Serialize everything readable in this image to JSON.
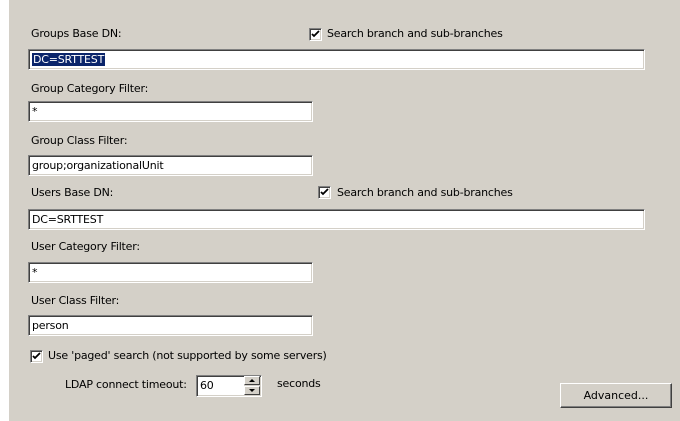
{
  "groups": {
    "base_dn_label": "Groups Base DN:",
    "search_branch_label": "Search branch and sub-branches",
    "search_branch_checked": true,
    "base_dn_value": "DC=SRTTEST",
    "category_filter_label": "Group Category Filter:",
    "category_filter_value": "*",
    "class_filter_label": "Group Class Filter:",
    "class_filter_value": "group;organizationalUnit"
  },
  "users": {
    "base_dn_label": "Users Base DN:",
    "search_branch_label": "Search branch and sub-branches",
    "search_branch_checked": true,
    "base_dn_value": "DC=SRTTEST",
    "category_filter_label": "User Category Filter:",
    "category_filter_value": "*",
    "class_filter_label": "User Class Filter:",
    "class_filter_value": "person"
  },
  "options": {
    "paged_search_label": "Use 'paged' search (not supported by some servers)",
    "paged_search_checked": true,
    "timeout_label": "LDAP connect timeout:",
    "timeout_value": "60",
    "timeout_unit": "seconds",
    "advanced_label": "Advanced..."
  },
  "colors": {
    "dialog_bg": "#d4d0c8",
    "selection_bg": "#0a246a",
    "selection_text": "#ffffff"
  }
}
